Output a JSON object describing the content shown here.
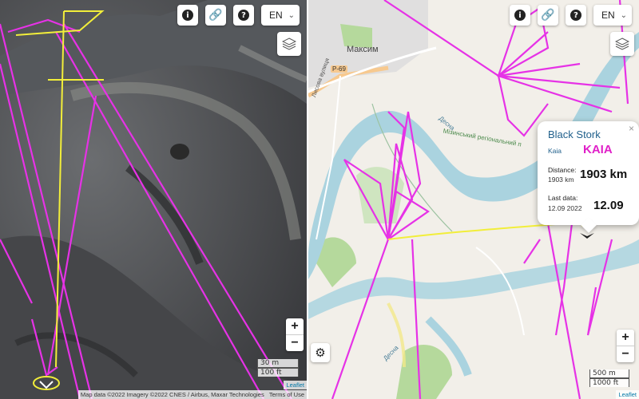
{
  "toolbar": {
    "info_icon": "i",
    "link_icon": "🔗",
    "help_icon": "?",
    "language": "EN"
  },
  "left_map": {
    "type": "satellite",
    "scale": {
      "metric": "30 m",
      "imperial": "100 ft"
    },
    "zoom_in": "+",
    "zoom_out": "−",
    "attribution": {
      "leaflet": "Leaflet",
      "imagery": "Map data ©2022 Imagery ©2022 CNES / Airbus, Maxar Technologies",
      "terms": "Terms of Use"
    }
  },
  "right_map": {
    "type": "street",
    "place_labels": {
      "town": "Максим",
      "road": "Р-69",
      "street": "Лисова вулиця",
      "river": "Десна",
      "park": "Мізинський регіональний п",
      "river_lower": "Десна"
    },
    "scale": {
      "metric": "500 m",
      "imperial": "1000 ft"
    },
    "zoom_in": "+",
    "zoom_out": "−",
    "attribution": {
      "leaflet": "Leaflet"
    }
  },
  "popup": {
    "species": "Black Stork",
    "name_small": "Kaia",
    "name_big": "KAIA",
    "distance_label": "Distance:",
    "distance_small": "1903 km",
    "distance_big": "1903 km",
    "last_data_label": "Last data:",
    "last_data_small": "12.09 2022",
    "last_data_big": "12.09",
    "close": "×"
  },
  "colors": {
    "track": "#e632e6",
    "highlight": "#f2ee3a",
    "popup_name": "#e020c8",
    "popup_title": "#1f5f8b",
    "river": "#aad3df",
    "park": "#b5d99c"
  },
  "icons": [
    "info-icon",
    "link-icon",
    "help-icon",
    "layers-icon",
    "gear-icon",
    "bird-marker-icon"
  ]
}
